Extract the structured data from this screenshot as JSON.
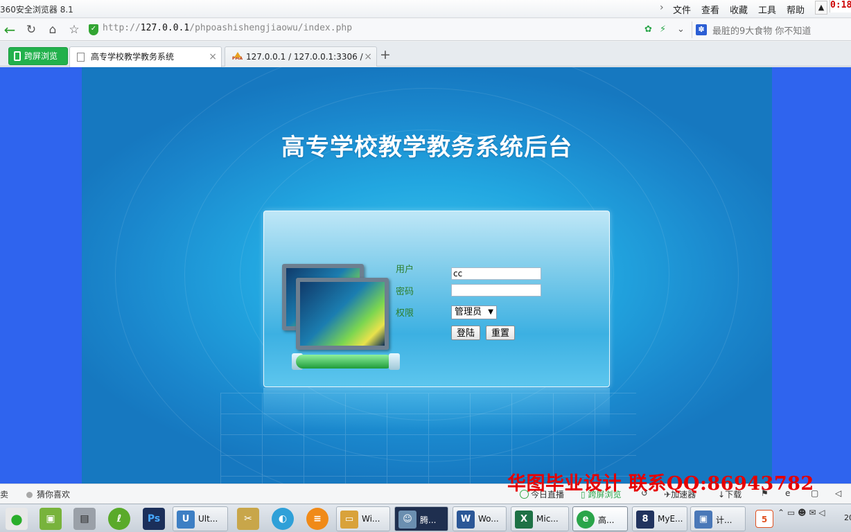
{
  "window": {
    "title": "360安全浏览器 8.1"
  },
  "menu": [
    "文件",
    "查看",
    "收藏",
    "工具",
    "帮助"
  ],
  "clock": "0:18",
  "address": {
    "scheme": "http://",
    "host": "127.0.0.1",
    "path": "/phpoashishengjiaowu/index.php",
    "search_suggest": "最脏的9大食物  你不知道"
  },
  "tabs": {
    "cross_screen": "跨屏浏览",
    "items": [
      {
        "label": "高专学校教学教务系统",
        "active": true
      },
      {
        "label": "127.0.0.1 / 127.0.0.1:3306 / ",
        "active": false
      }
    ]
  },
  "page": {
    "heading": "高专学校教学教务系统后台",
    "form": {
      "user_label": "用户",
      "user_value": "cc",
      "password_label": "密码",
      "role_label": "权限",
      "role_selected": "管理员",
      "login_button": "登陆",
      "reset_button": "重置"
    }
  },
  "statusbar": {
    "left_cut": "卖",
    "guess": "猜你喜欢",
    "live": "今日直播",
    "cross": "跨屏浏览",
    "accel": "加速器",
    "download": "下载"
  },
  "watermark": "华图毕业设计 联系QQ:86943782",
  "taskbar": {
    "tasks": [
      {
        "label": "Ult...",
        "color": "#3d7fc4"
      },
      {
        "label": "Wi...",
        "color": "#d9a23a"
      },
      {
        "label": "腾...",
        "color": "#6b8fb0"
      },
      {
        "label": "Wo...",
        "color": "#2b5797"
      },
      {
        "label": "Mic...",
        "color": "#1e7145"
      },
      {
        "label": "高...",
        "color": "#2aa54a"
      },
      {
        "label": "MyE...",
        "color": "#21335e"
      },
      {
        "label": "计...",
        "color": "#4a78b8"
      }
    ],
    "year": "20"
  },
  "colors": {
    "page_background": "#2f64ee",
    "stage_background": "#22a6e0",
    "label_green": "#2d7f2d",
    "watermark_red": "#e60000"
  }
}
